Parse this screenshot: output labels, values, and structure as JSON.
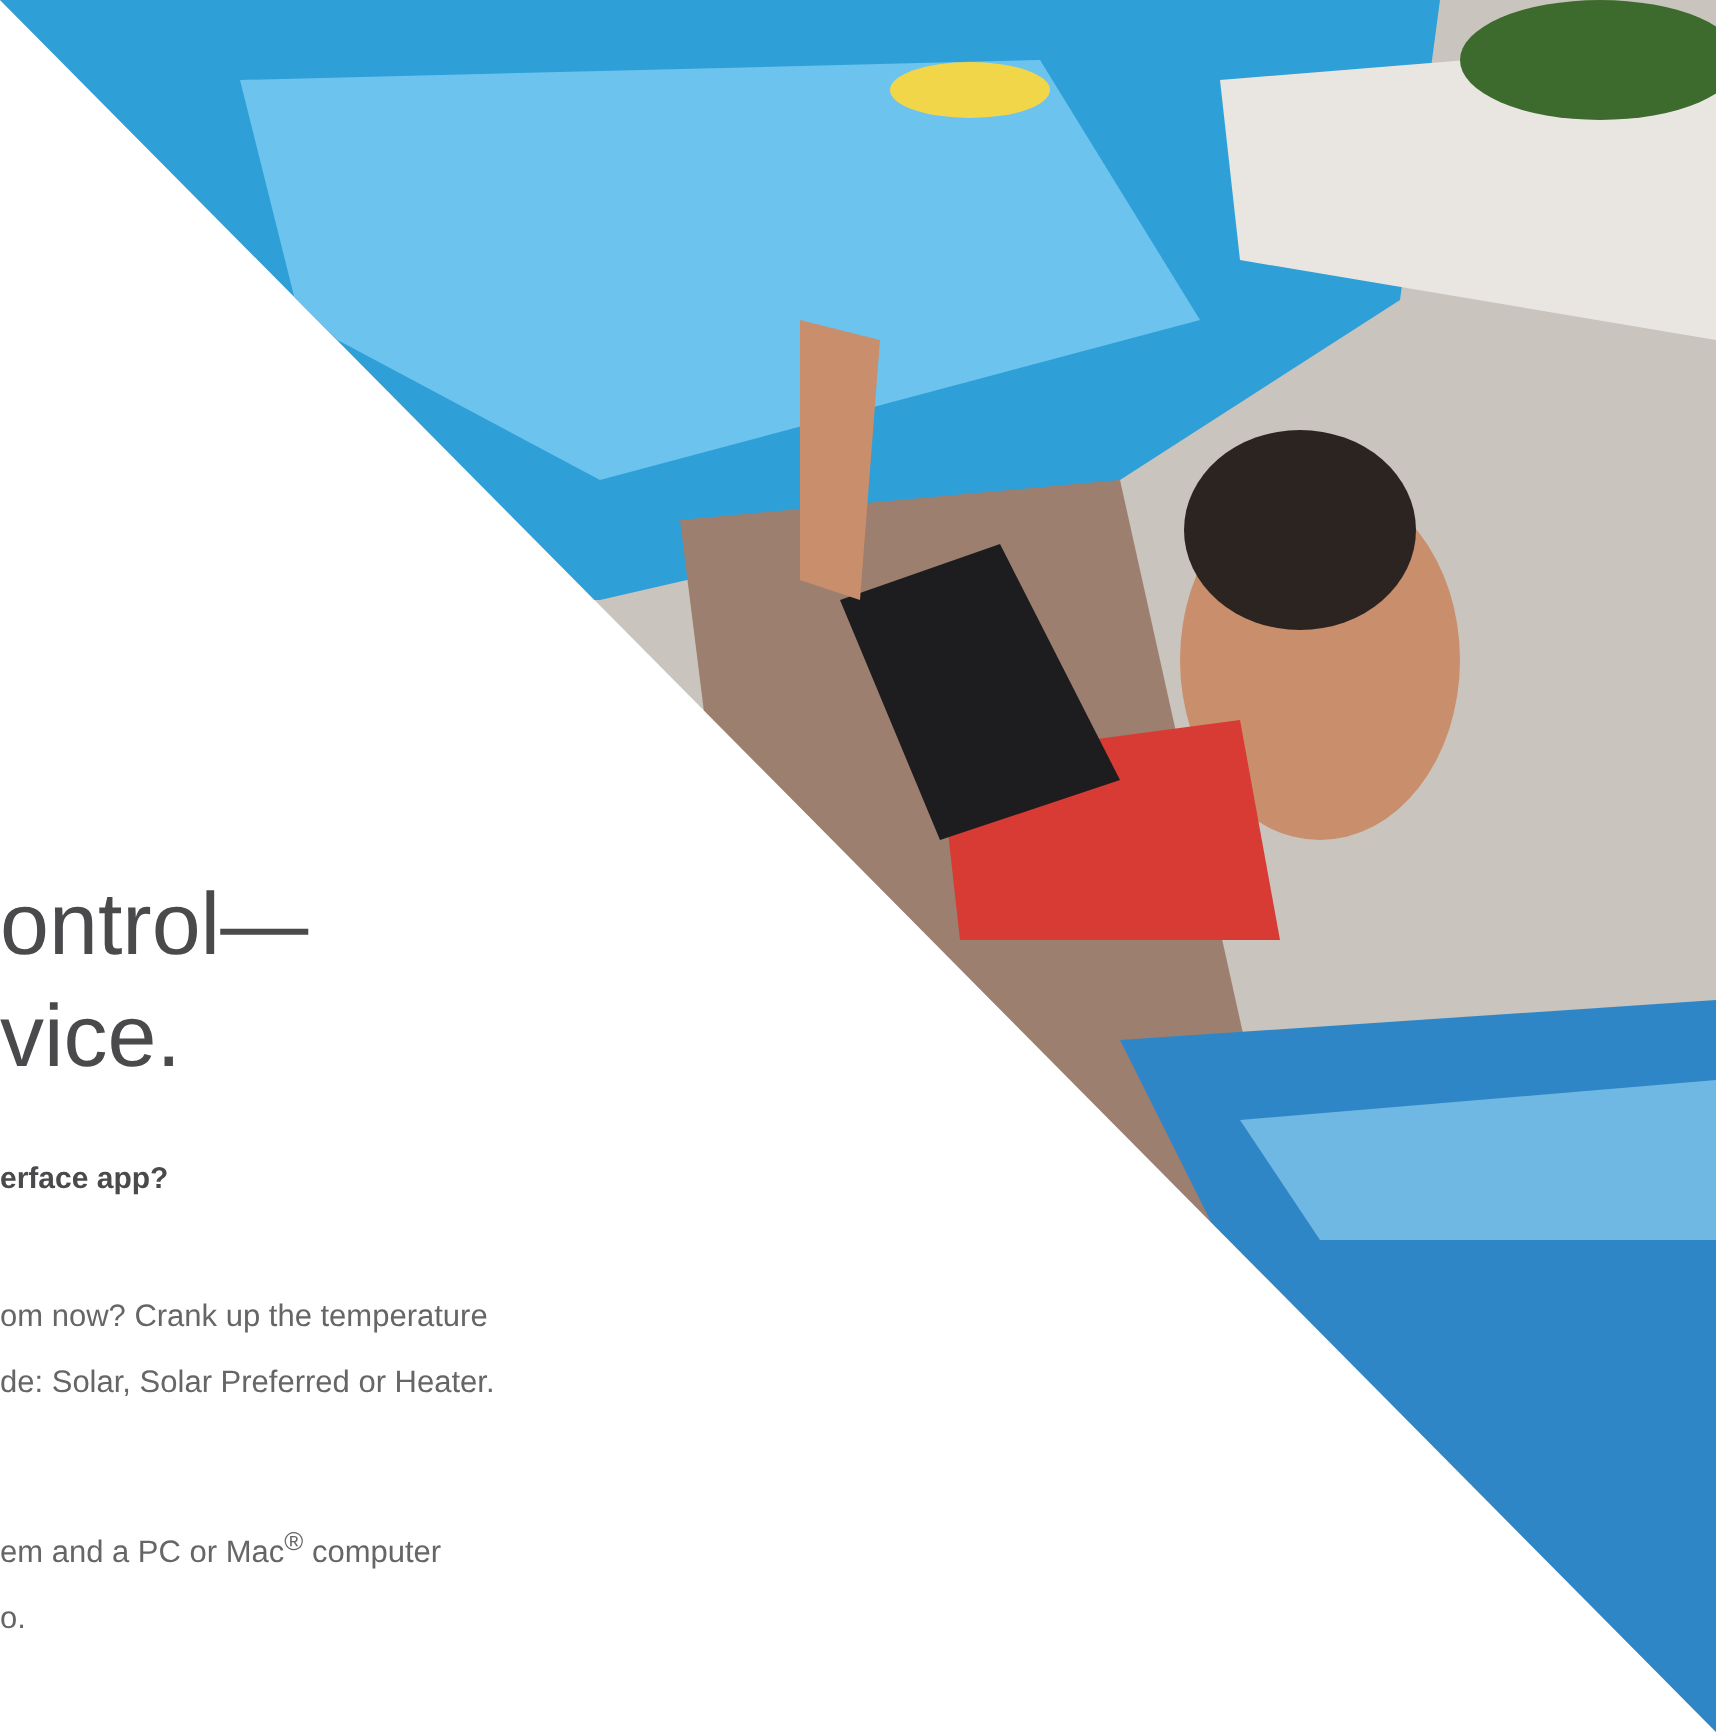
{
  "headline": [
    "ontrol—",
    "vice."
  ],
  "subheading": "erface app?",
  "paragraphs": [
    [
      "om now? Crank up the temperature",
      "de: Solar, Solar Preferred or Heater."
    ],
    [
      "em and a PC or Mac$^{®}$ computer",
      "o."
    ]
  ]
}
